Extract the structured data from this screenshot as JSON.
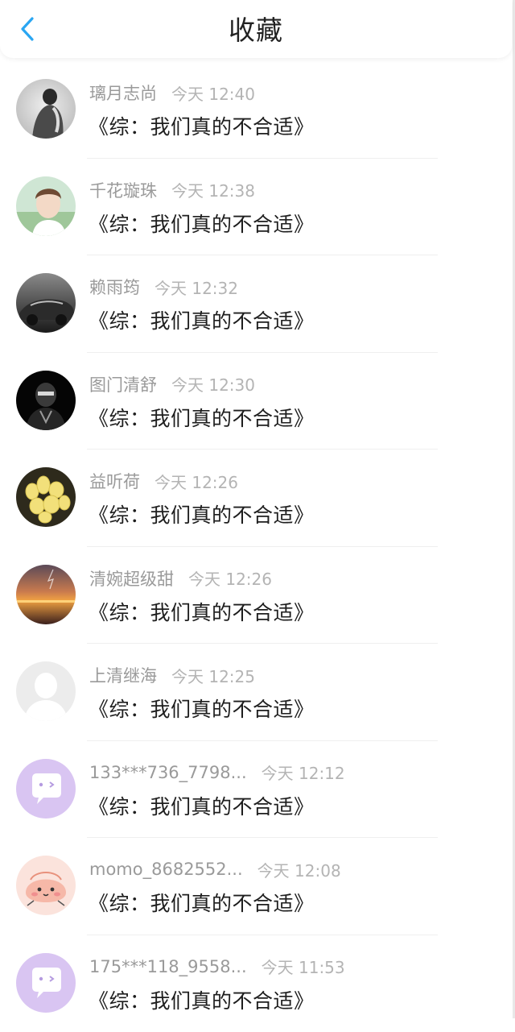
{
  "header": {
    "title": "收藏",
    "back_icon": "chevron-left-icon",
    "accent_color": "#2aa6f2"
  },
  "items": [
    {
      "name": "璃月志尚",
      "time": "今天 12:40",
      "book": "《综：我们真的不合适》",
      "avatar": "photo-silhouette"
    },
    {
      "name": "千花璇珠",
      "time": "今天 12:38",
      "book": "《综：我们真的不合适》",
      "avatar": "photo-portrait"
    },
    {
      "name": "赖雨筠",
      "time": "今天 12:32",
      "book": "《综：我们真的不合适》",
      "avatar": "photo-car"
    },
    {
      "name": "图门清舒",
      "time": "今天 12:30",
      "book": "《综：我们真的不合适》",
      "avatar": "photo-dark-figure"
    },
    {
      "name": "益听荷",
      "time": "今天 12:26",
      "book": "《综：我们真的不合适》",
      "avatar": "photo-yellow-flowers"
    },
    {
      "name": "清婉超级甜",
      "time": "今天 12:26",
      "book": "《综：我们真的不合适》",
      "avatar": "photo-sunset"
    },
    {
      "name": "上清继海",
      "time": "今天 12:25",
      "book": "《综：我们真的不合适》",
      "avatar": "default-user"
    },
    {
      "name": "133***736_7798...",
      "time": "今天 12:12",
      "book": "《综：我们真的不合适》",
      "avatar": "chat-bubble-purple"
    },
    {
      "name": "momo_8682552...",
      "time": "今天 12:08",
      "book": "《综：我们真的不合适》",
      "avatar": "cartoon-pink"
    },
    {
      "name": "175***118_9558...",
      "time": "今天 11:53",
      "book": "《综：我们真的不合适》",
      "avatar": "chat-bubble-purple"
    }
  ]
}
